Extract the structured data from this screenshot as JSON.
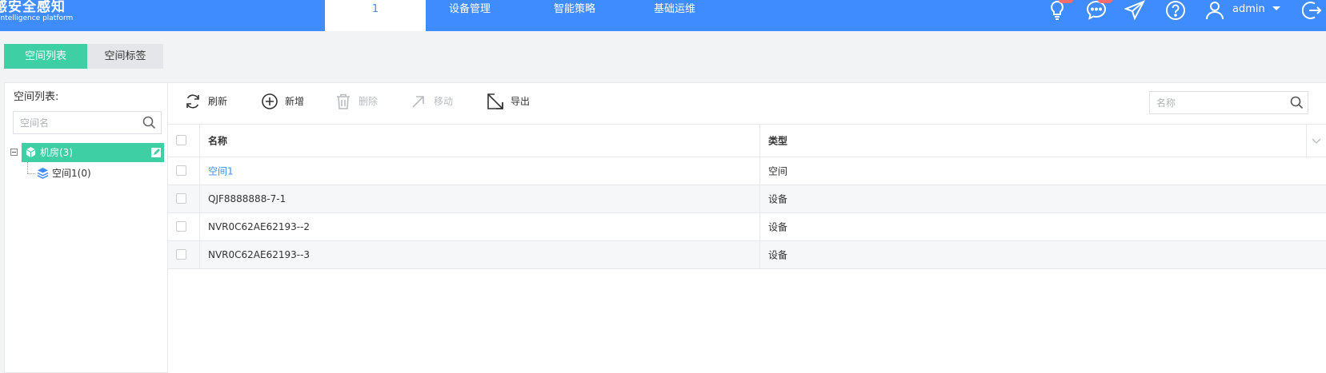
{
  "header": {
    "logo_title": "感安全感知",
    "logo_subtitle": "intelligence platform",
    "nav_tabs": [
      {
        "label": "1"
      },
      {
        "label": "设备管理"
      },
      {
        "label": "智能策略"
      },
      {
        "label": "基础运维"
      }
    ],
    "user": "admin",
    "icons": [
      "lightbulb-icon",
      "chat-icon",
      "send-icon",
      "help-icon",
      "user-icon",
      "caret-down-icon",
      "logout-icon"
    ],
    "accent_color": "#3f8cff",
    "badge_color": "#f56c6c"
  },
  "subtabs": [
    {
      "label": "空间列表",
      "active": true
    },
    {
      "label": "空间标签",
      "active": false
    }
  ],
  "left_panel": {
    "title": "空间列表:",
    "search_placeholder": "空间名",
    "tree": {
      "root": {
        "label": "机房(3)"
      },
      "children": [
        {
          "label": "空间1(0)"
        }
      ]
    },
    "selected_color": "#3ecfa4"
  },
  "toolbar": {
    "refresh": "刷新",
    "add": "新增",
    "delete": "删除",
    "move": "移动",
    "export": "导出",
    "search_placeholder": "名称"
  },
  "table": {
    "columns": [
      "名称",
      "类型"
    ],
    "rows": [
      {
        "name": "空间1",
        "type": "空间"
      },
      {
        "name": "QJF8888888-7-1",
        "type": "设备"
      },
      {
        "name": "NVR0C62AE62193--2",
        "type": "设备"
      },
      {
        "name": "NVR0C62AE62193--3",
        "type": "设备"
      }
    ]
  }
}
